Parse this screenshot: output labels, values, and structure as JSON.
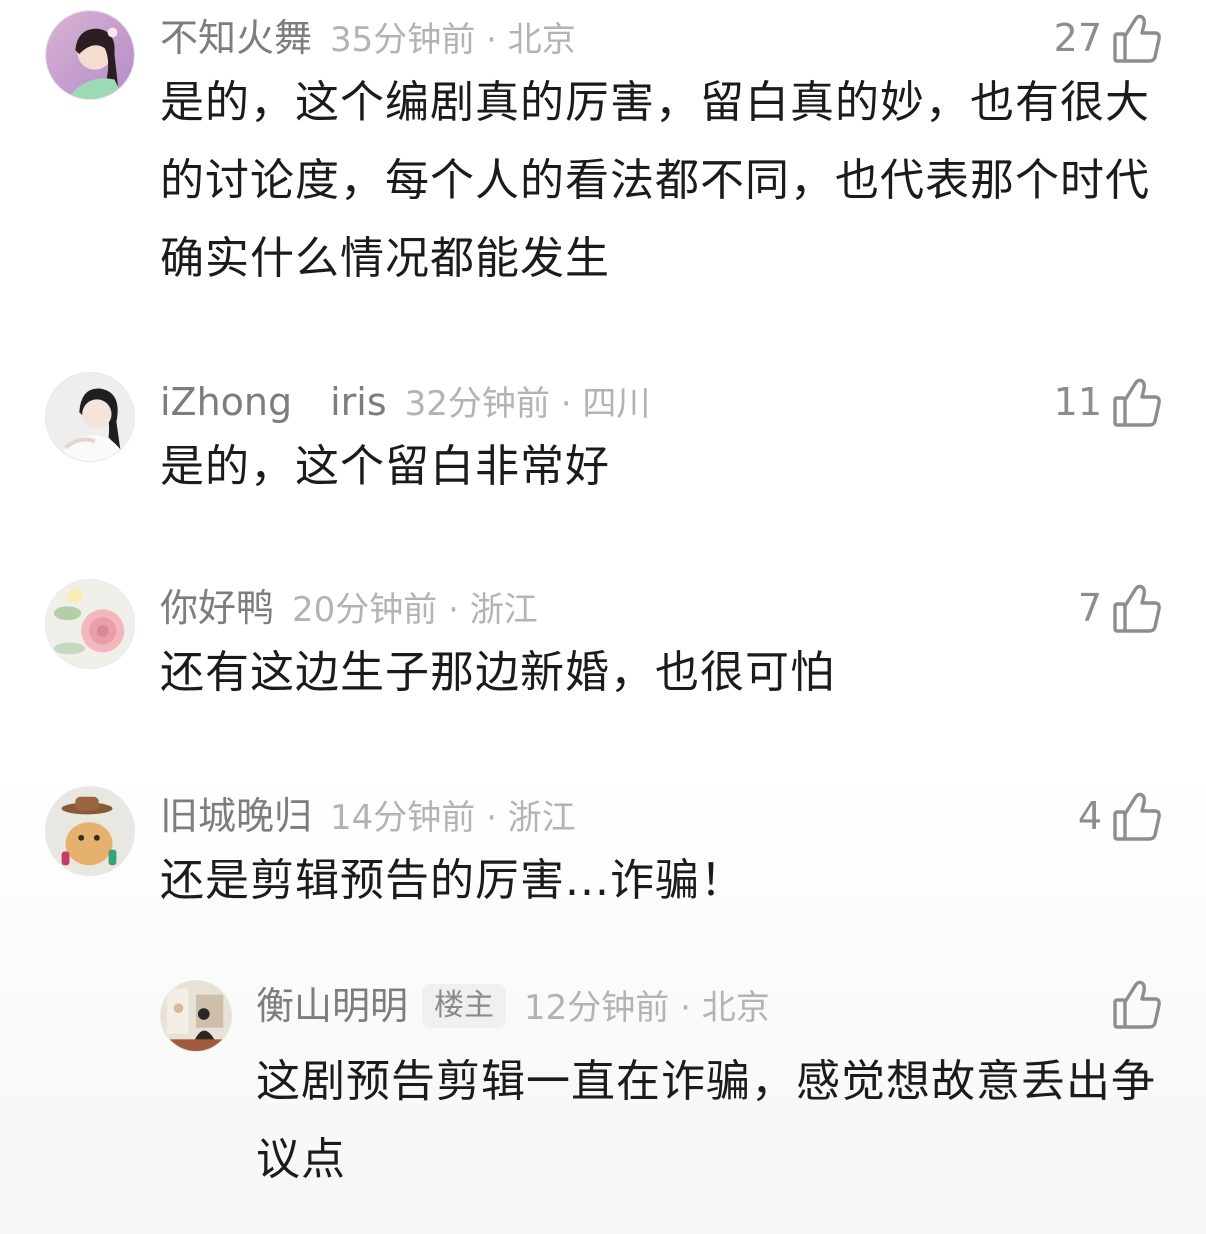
{
  "comments": [
    {
      "username": "不知火舞",
      "time_location": "35分钟前 · 北京",
      "likes": "27",
      "text": "是的，这个编剧真的厉害，留白真的妙，也有很大的讨论度，每个人的看法都不同，也代表那个时代确实什么情况都能发生"
    },
    {
      "username": "iZhong　iris",
      "time_location": "32分钟前 · 四川",
      "likes": "11",
      "text": "是的，这个留白非常好"
    },
    {
      "username": "你好鸭",
      "time_location": "20分钟前 · 浙江",
      "likes": "7",
      "text": "还有这边生子那边新婚，也很可怕"
    },
    {
      "username": "旧城晚归",
      "time_location": "14分钟前 · 浙江",
      "likes": "4",
      "text": "还是剪辑预告的厉害...诈骗！"
    }
  ],
  "reply": {
    "username": "衡山明明",
    "badge": "楼主",
    "time_location": "12分钟前 · 北京",
    "text": "这剧预告剪辑一直在诈骗，感觉想故意丢出争议点"
  },
  "icons": {
    "like": "thumbs-up-icon"
  }
}
